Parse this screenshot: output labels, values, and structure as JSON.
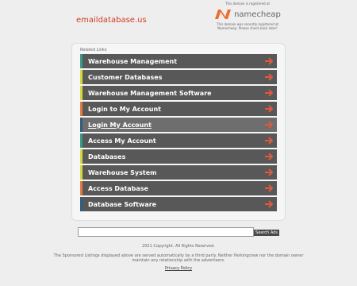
{
  "domain": "emaildatabase.us",
  "registrar": {
    "top_note": "This domain is registered at",
    "brand": "namecheap",
    "note": "This domain was recently registered at Namecheap. Please check back later!",
    "logo_color": "#ef6c2e"
  },
  "related_links": {
    "title": "Related Links",
    "items": [
      {
        "label": "Warehouse Management",
        "color": "#3a9a87"
      },
      {
        "label": "Customer Databases",
        "color": "#d1d93d"
      },
      {
        "label": "Warehouse Management Software",
        "color": "#d1d93d"
      },
      {
        "label": "Login to My Account",
        "color": "#e57a40"
      },
      {
        "label": "Login My Account",
        "color": "#2f5f7a"
      },
      {
        "label": "Access My Account",
        "color": "#3a9a87"
      },
      {
        "label": "Databases",
        "color": "#d1d93d"
      },
      {
        "label": "Warehouse System",
        "color": "#d1d93d"
      },
      {
        "label": "Access Database",
        "color": "#e57a40"
      },
      {
        "label": "Database Software",
        "color": "#2f5f7a"
      }
    ],
    "arrow_color": "#e05a3a"
  },
  "search": {
    "value": "",
    "button_label": "Search Ads"
  },
  "footer": {
    "copyright": "2021 Copyright. All Rights Reserved.",
    "disclaimer": "The Sponsored Listings displayed above are served automatically by a third party. Neither Parkingcrew nor the domain owner maintain any relationship with the advertisers.",
    "privacy": "Privacy Policy"
  }
}
